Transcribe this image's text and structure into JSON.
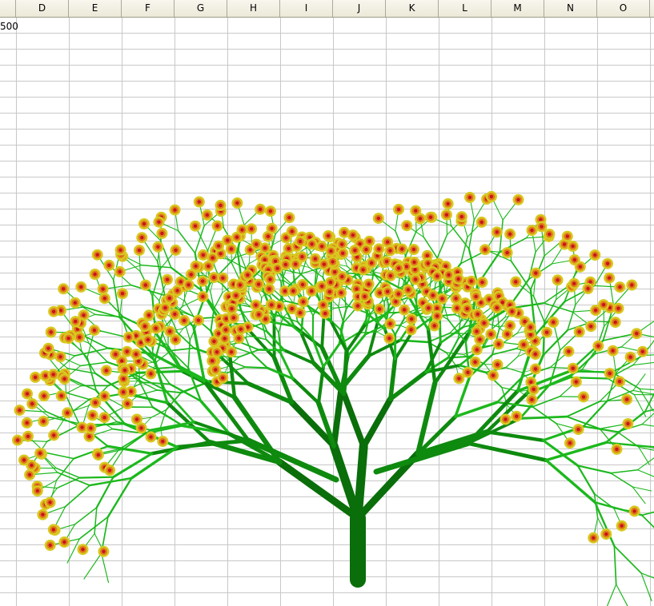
{
  "spreadsheet": {
    "columns": [
      "D",
      "E",
      "F",
      "G",
      "H",
      "I",
      "J",
      "K",
      "L",
      "M",
      "N",
      "O"
    ],
    "first_cell_value": "500"
  },
  "drawing": {
    "subject": "tree",
    "trunk_color": "#0a6e0a",
    "branch_color": "#0e8a0e",
    "twig_color": "#1cb81c",
    "flower_outer_color": "#d8c81e",
    "flower_middle_color": "#e07a1c",
    "flower_center_color": "#c8141c"
  },
  "colors": {
    "grid_line": "#c8c8c8",
    "header_bg": "#ece9d8"
  }
}
